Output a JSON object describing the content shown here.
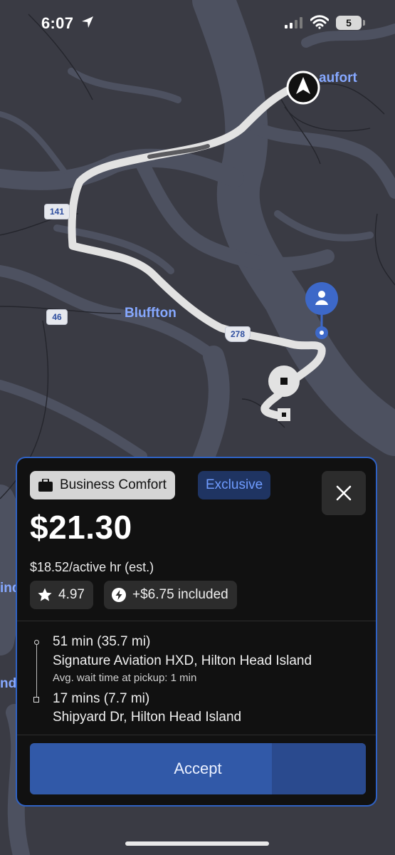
{
  "status_bar": {
    "time": "6:07",
    "battery": "5"
  },
  "map": {
    "labels": {
      "beaufort": "aufort",
      "bluffton": "Bluffton",
      "edge1": "ind",
      "edge2": "nd"
    },
    "shields": {
      "r141": "141",
      "r46": "46",
      "r278": "278"
    }
  },
  "offer": {
    "product": "Business Comfort",
    "tag": "Exclusive",
    "price": "$21.30",
    "rate": "$18.52/active hr (est.)",
    "rating": "4.97",
    "boost": "+$6.75 included",
    "pickup": {
      "duration": "51 min (35.7 mi)",
      "location": "Signature Aviation HXD, Hilton Head Island",
      "wait_note": "Avg. wait time at pickup: 1 min"
    },
    "dropoff": {
      "duration": "17 mins (7.7 mi)",
      "location": "Shipyard Dr, Hilton Head Island"
    },
    "accept_label": "Accept"
  },
  "colors": {
    "accent": "#3159a8",
    "map_water": "#4d5160",
    "map_land": "#3a3b44",
    "route": "#d6d6d6",
    "pin": "#3d68c8"
  }
}
